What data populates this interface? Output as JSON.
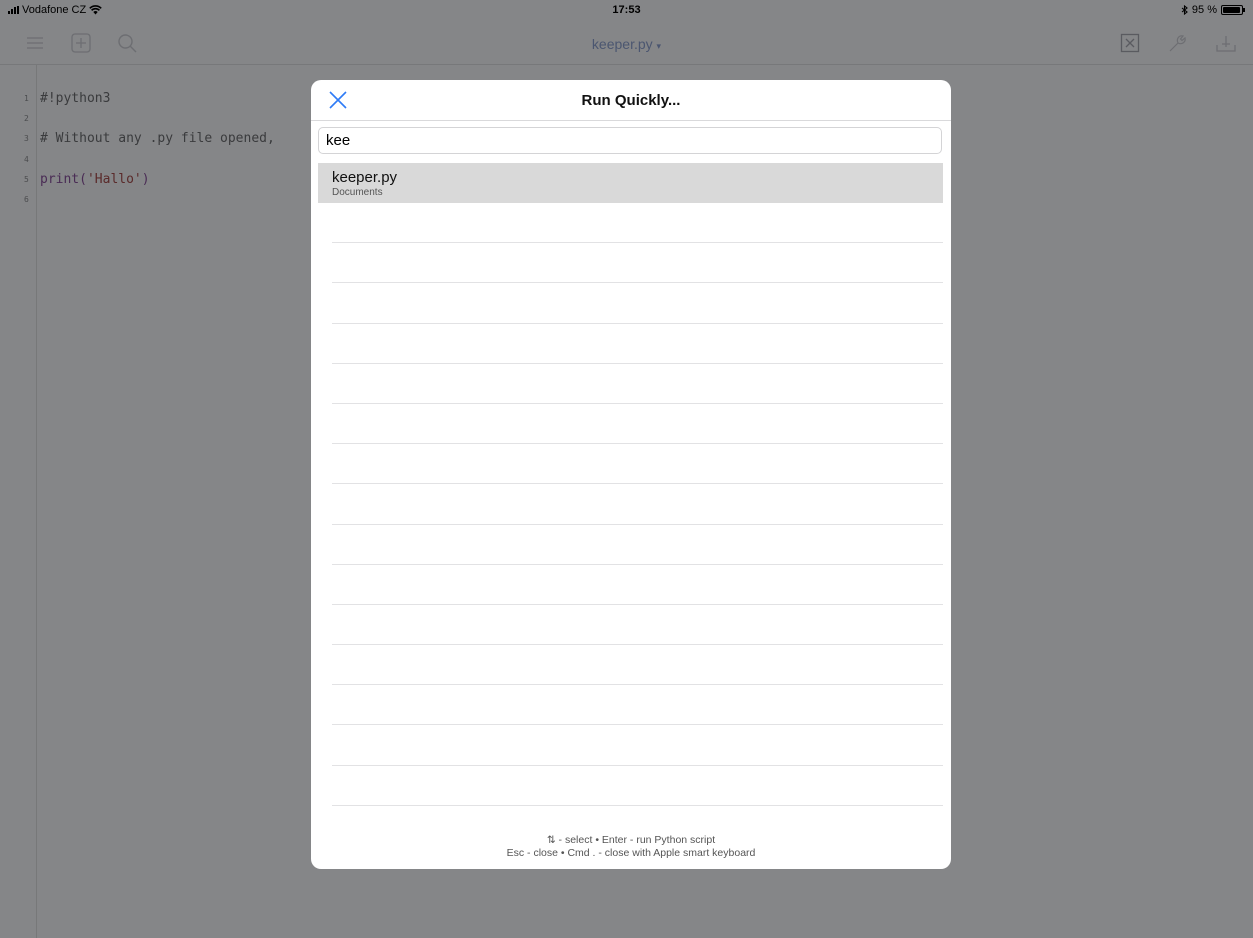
{
  "status_bar": {
    "carrier": "Vodafone CZ",
    "time": "17:53",
    "battery_text": "95 %",
    "battery_level": 0.95
  },
  "toolbar": {
    "file_title": "keeper.py",
    "dropdown_marker": "▾"
  },
  "editor": {
    "lines": [
      {
        "number": "1",
        "code": "#!python3"
      },
      {
        "number": "2",
        "code": ""
      },
      {
        "number": "3",
        "code": "# Without any .py file opened,"
      },
      {
        "number": "4",
        "code": ""
      },
      {
        "number": "5",
        "code_parts": [
          "print(",
          "'Hallo'",
          ")"
        ]
      },
      {
        "number": "6",
        "code": ""
      }
    ]
  },
  "modal": {
    "title": "Run Quickly...",
    "search_value": "kee",
    "results": [
      {
        "name": "keeper.py",
        "location": "Documents",
        "selected": true
      }
    ],
    "empty_rows": 15,
    "footer_line1": "⇅ - select • Enter - run Python script",
    "footer_line2": "Esc - close • Cmd . - close with Apple smart keyboard"
  },
  "colors": {
    "accent": "#2f7bf6",
    "dim_background": "#858688",
    "selected_row": "#d9d9d9"
  },
  "icons": [
    "wifi-icon",
    "bluetooth-icon",
    "battery-icon",
    "menu-icon",
    "add-icon",
    "search-icon",
    "close-file-icon",
    "wrench-icon",
    "share-icon",
    "close-icon"
  ]
}
